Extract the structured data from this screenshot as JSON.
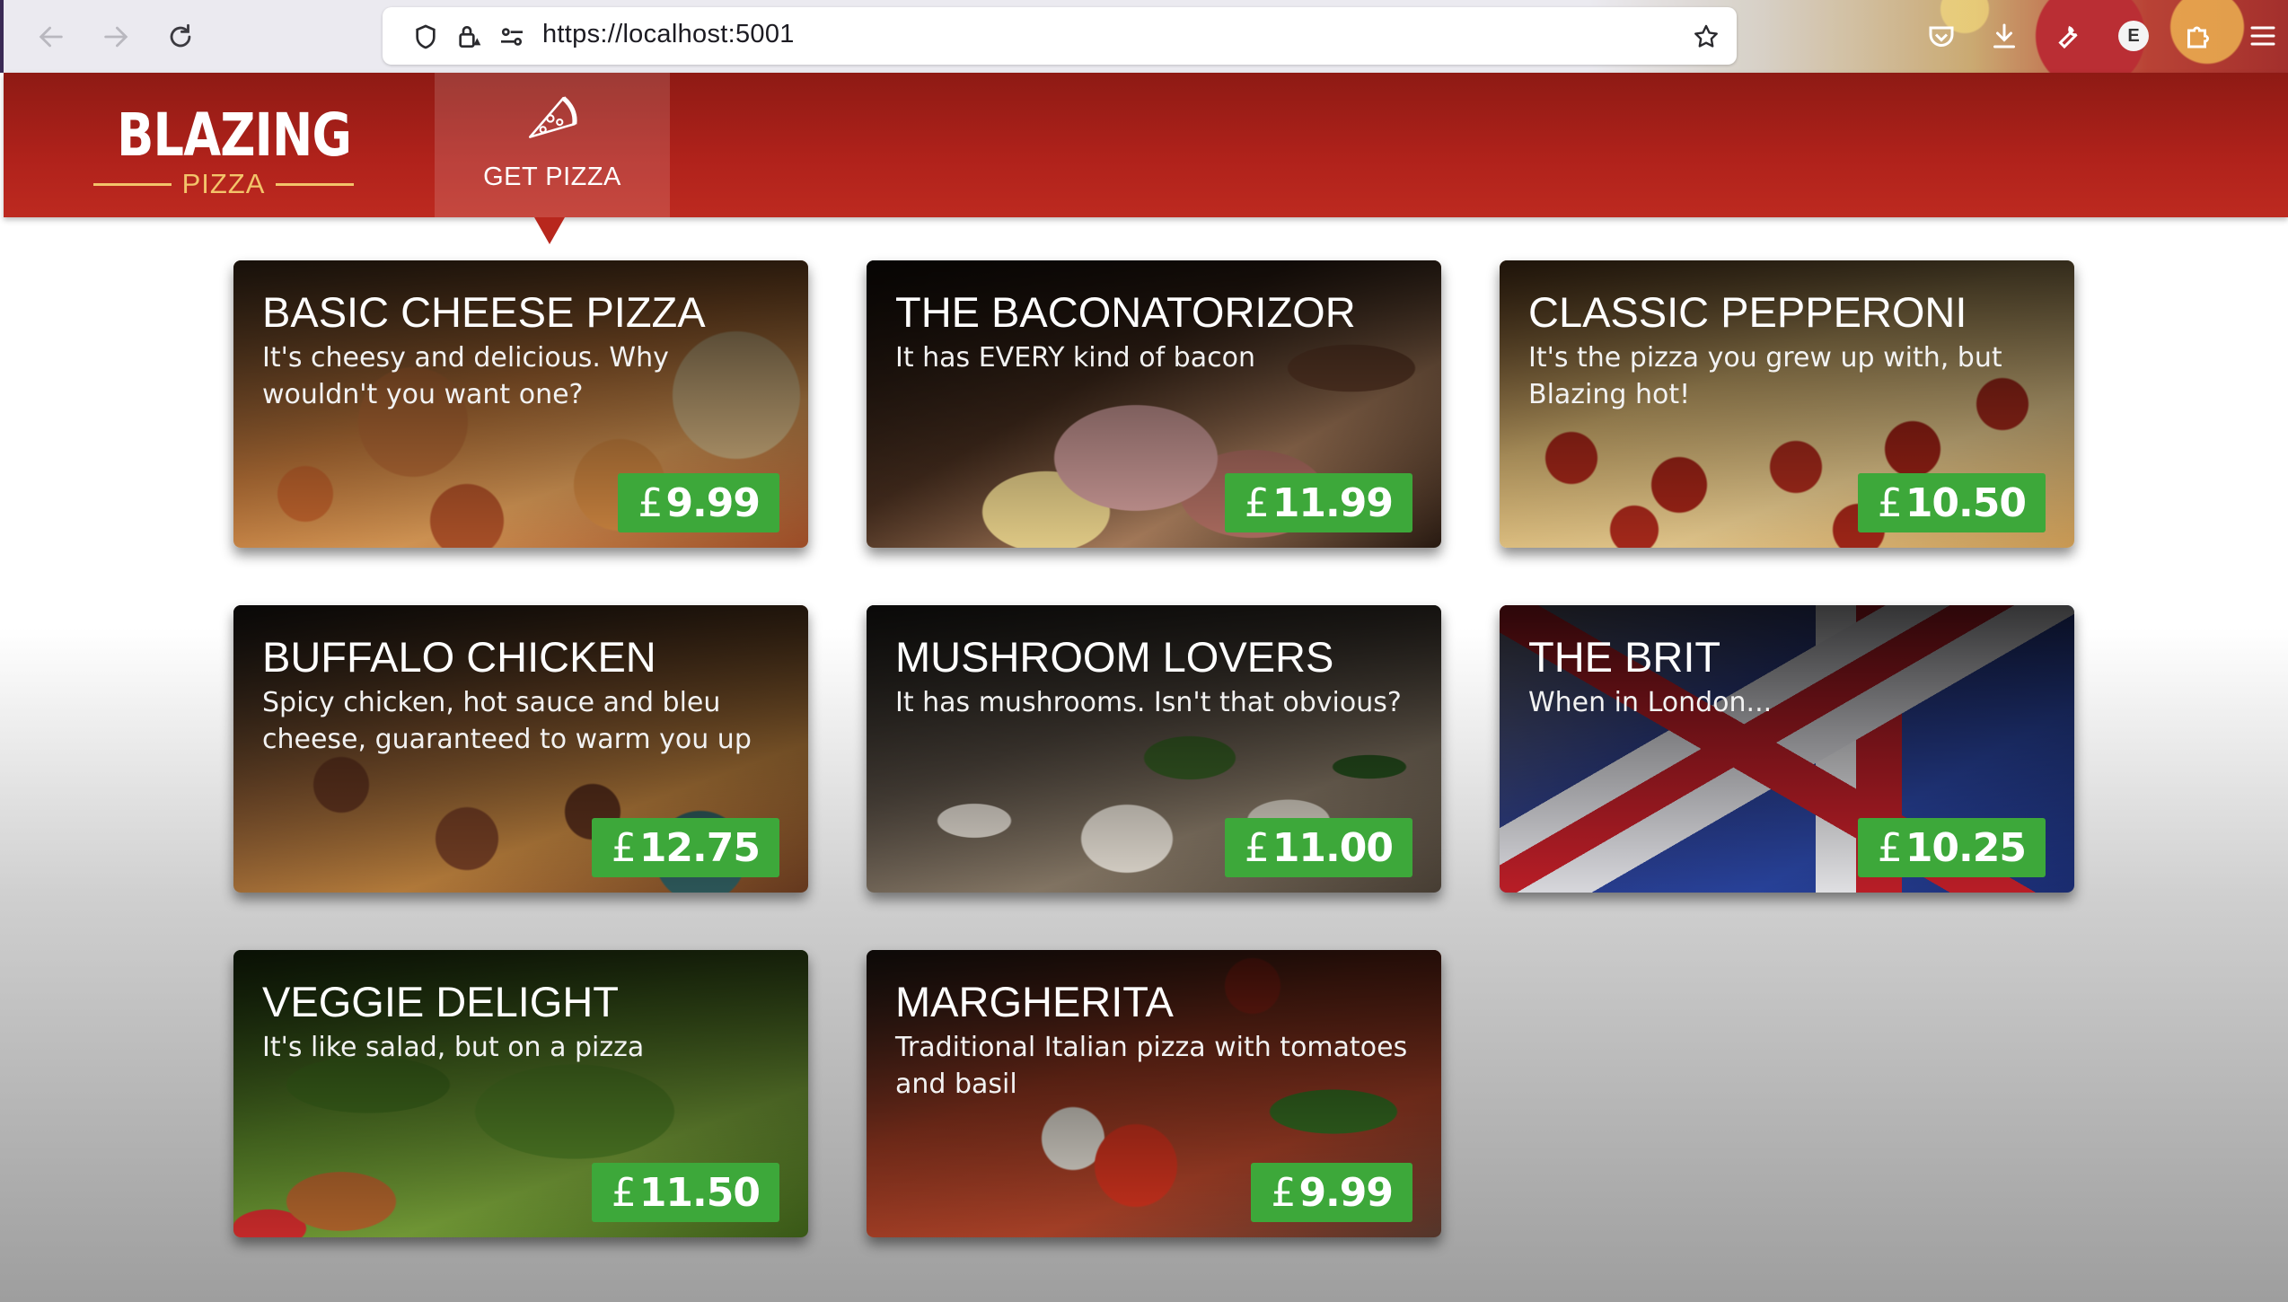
{
  "browser": {
    "url": "https://localhost:5001",
    "account_initial": "E"
  },
  "app": {
    "logo_main": "BLAZING",
    "logo_sub": "PIZZA",
    "nav_tab_label": "GET PIZZA",
    "colors": {
      "header": "#b0221b",
      "logo_accent": "#f3c46a",
      "price_badge": "#3da83a"
    }
  },
  "specials": [
    {
      "name": "Basic Cheese Pizza",
      "description": "It's cheesy and delicious. Why wouldn't you want one?",
      "currency": "£",
      "price": "9.99"
    },
    {
      "name": "The Baconatorizor",
      "description": "It has EVERY kind of bacon",
      "currency": "£",
      "price": "11.99"
    },
    {
      "name": "Classic pepperoni",
      "description": "It's the pizza you grew up with, but Blazing hot!",
      "currency": "£",
      "price": "10.50"
    },
    {
      "name": "Buffalo chicken",
      "description": "Spicy chicken, hot sauce and bleu cheese, guaranteed to warm you up",
      "currency": "£",
      "price": "12.75"
    },
    {
      "name": "Mushroom Lovers",
      "description": "It has mushrooms. Isn't that obvious?",
      "currency": "£",
      "price": "11.00"
    },
    {
      "name": "The Brit",
      "description": "When in London...",
      "currency": "£",
      "price": "10.25"
    },
    {
      "name": "Veggie Delight",
      "description": "It's like salad, but on a pizza",
      "currency": "£",
      "price": "11.50"
    },
    {
      "name": "Margherita",
      "description": "Traditional Italian pizza with tomatoes and basil",
      "currency": "£",
      "price": "9.99"
    }
  ]
}
